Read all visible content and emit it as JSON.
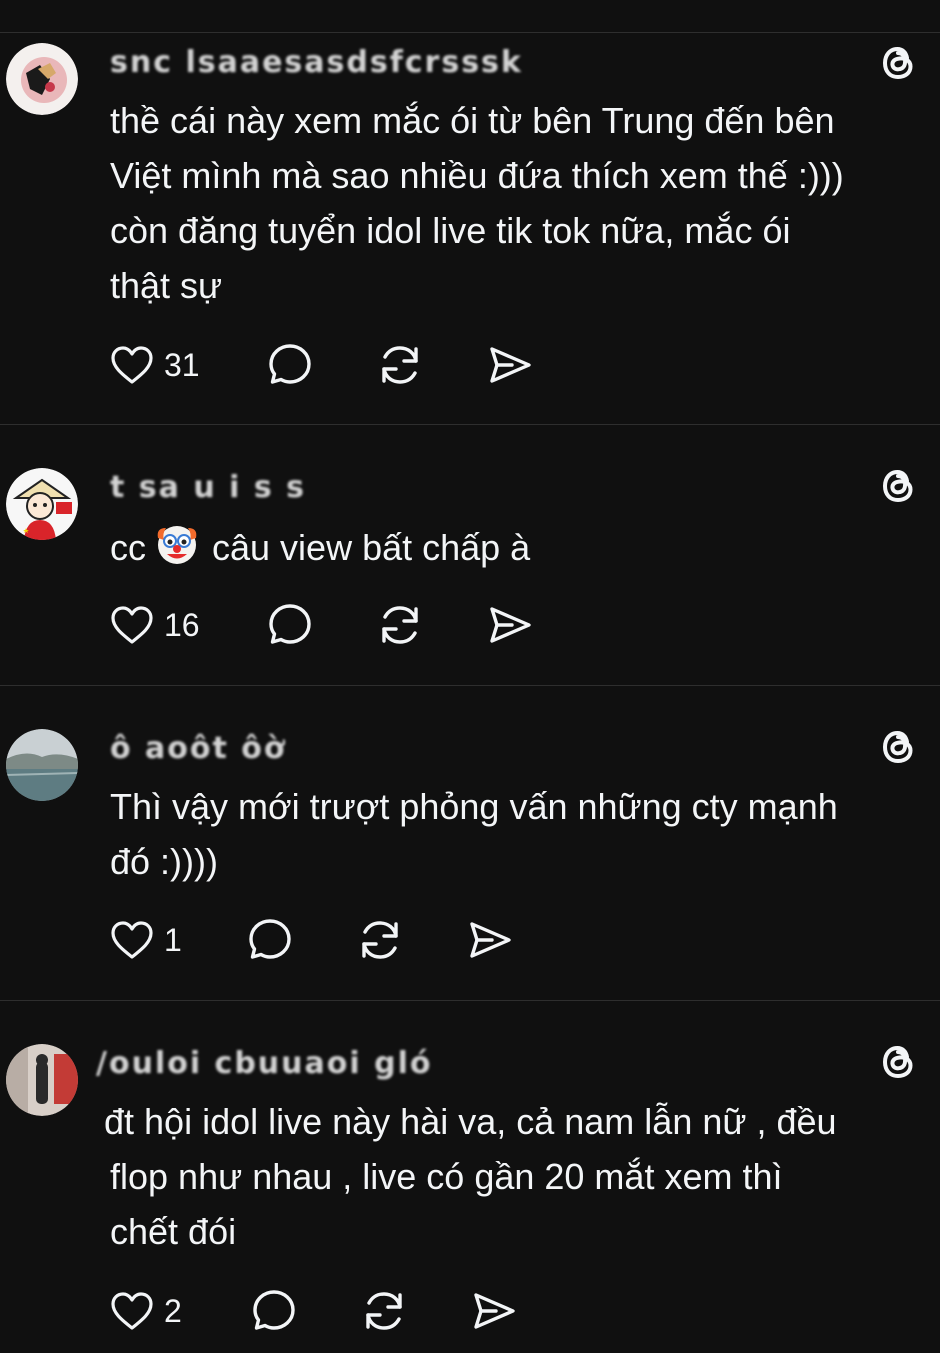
{
  "feed": {
    "posts": [
      {
        "username": "snc lsaaesasdsfcrsssk",
        "lines": [
          "thề cái này xem mắc ói từ bên Trung đến bên",
          "Việt mình mà sao nhiều đứa thích xem thế :)))",
          "còn đăng tuyển idol live tik tok nữa, mắc ói",
          "thật sự"
        ],
        "likes": "31"
      },
      {
        "username": "t sa u  i s   s",
        "prefix": "cc",
        "emoji": "clown-face",
        "text_after_emoji": "câu view bất chấp à",
        "likes": "16"
      },
      {
        "username": "ô aoôt   ôờ",
        "lines": [
          "Thì vậy mới trượt phỏng vấn những cty mạnh",
          "đó :))))"
        ],
        "likes": "1"
      },
      {
        "username": "/ouloi cbuuaoi gló",
        "lines": [
          "đt hội idol live này hài va, cả nam lẫn nữ , đều",
          "flop như nhau , live có gần 20 mắt xem thì",
          "chết đói"
        ],
        "likes": "2"
      }
    ]
  },
  "icons": {
    "like": "heart-icon",
    "reply": "reply-bubble-icon",
    "repost": "repost-icon",
    "share": "share-send-icon",
    "app": "threads-logo-icon"
  },
  "colors": {
    "background": "#101010",
    "text": "#f3f5f7",
    "divider": "#2e2e2e"
  }
}
